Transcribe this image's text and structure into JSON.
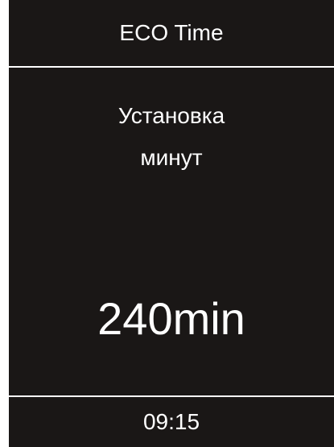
{
  "header": {
    "title": "ECO Time"
  },
  "main": {
    "label_line1": "Установка",
    "label_line2": "минут",
    "value": "240min"
  },
  "footer": {
    "time": "09:15"
  },
  "colors": {
    "background": "#1a1716",
    "text": "#ffffff"
  }
}
